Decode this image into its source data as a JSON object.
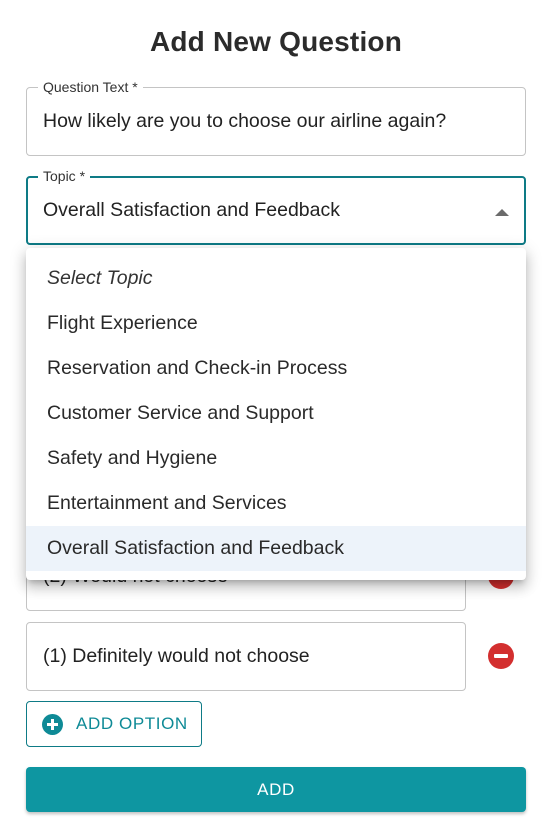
{
  "page": {
    "title": "Add New Question"
  },
  "question_field": {
    "label": "Question Text *",
    "value": "How likely are you to choose our airline again?"
  },
  "topic_field": {
    "label": "Topic *",
    "value": "Overall Satisfaction and Feedback"
  },
  "topic_menu": {
    "items": [
      "Select Topic",
      "Flight Experience",
      "Reservation and Check-in Process",
      "Customer Service and Support",
      "Safety and Hygiene",
      "Entertainment and Services",
      "Overall Satisfaction and Feedback"
    ],
    "selected": "Overall Satisfaction and Feedback"
  },
  "options": [
    {
      "value": "(2) Would not choose"
    },
    {
      "value": "(1) Definitely would not choose"
    }
  ],
  "buttons": {
    "add_option": "ADD OPTION",
    "add": "ADD"
  },
  "colors": {
    "accent": "#0e96a1",
    "accent_dark": "#0e7b86",
    "danger": "#d32f2f",
    "selected_bg": "#edf3fa"
  },
  "icons": {
    "remove": "remove-circle-icon",
    "add_option": "add-circle-icon",
    "dropdown": "caret-up-icon"
  }
}
